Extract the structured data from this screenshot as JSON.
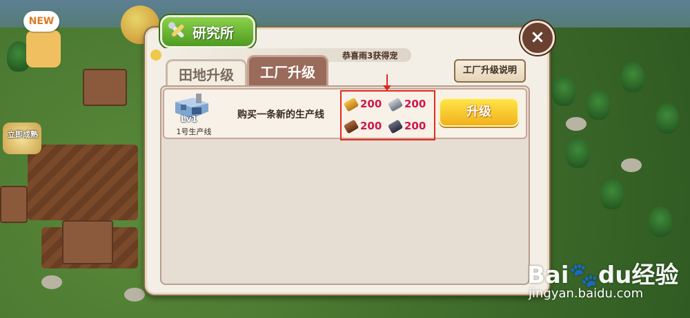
{
  "background": {
    "new_badge": "NEW",
    "ready_label": "立即成熟",
    "colors": {
      "grass": "#3f6d2b",
      "sky": "#5d7f93"
    }
  },
  "dialog": {
    "title": "研究所",
    "close_label": "×",
    "ticker_text": "恭喜雨3获得宠",
    "tabs": [
      {
        "label": "田地升级",
        "active": false
      },
      {
        "label": "工厂升级",
        "active": true
      }
    ],
    "help_button": "工厂升级说明",
    "row": {
      "level": "Lv1",
      "name": "1号生产线",
      "description": "购买一条新的生产线",
      "costs": [
        {
          "icon": "gold-ore-icon",
          "amount": "200"
        },
        {
          "icon": "silver-ore-icon",
          "amount": "200"
        },
        {
          "icon": "copper-ore-icon",
          "amount": "200"
        },
        {
          "icon": "dark-ore-icon",
          "amount": "200"
        }
      ],
      "upgrade_button": "升级"
    },
    "colors": {
      "cost_text": "#d0154a",
      "highlight": "#e0281e",
      "upgrade_button": "#f2b01a"
    }
  },
  "watermark": {
    "brand": "Bai",
    "brand2": "du",
    "label": "经验",
    "url": "jingyan.baidu.com"
  }
}
